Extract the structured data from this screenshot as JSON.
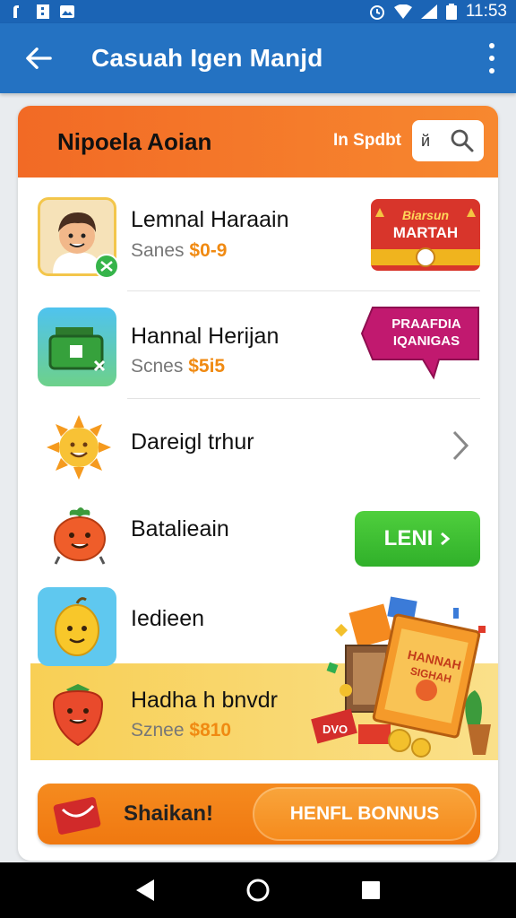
{
  "status_bar": {
    "time": "11:53"
  },
  "app_bar": {
    "title": "Casuah Igen Manjd"
  },
  "card": {
    "title": "Nipoela Aoian",
    "header_label": "In Spdbt",
    "search": {
      "value": "й"
    }
  },
  "rows": [
    {
      "title": "Lemnal Haraain",
      "sub_label": "Sanes",
      "price": "$0-9",
      "badge_line1": "Biarsun",
      "badge_line2": "MARTAH"
    },
    {
      "title": "Hannal Herijan",
      "sub_label": "Scnes",
      "price": "$5i5",
      "badge_line1": "PRAAFDIA",
      "badge_line2": "IQANIGAS"
    },
    {
      "title": "Dareigl trhur"
    },
    {
      "title": "Batalieain",
      "button_label": "LENI"
    },
    {
      "title": "Iedieen"
    },
    {
      "title": "Hadha h bnvdr",
      "sub_label": "Sznee",
      "price": "$810",
      "book_label1": "HANNAH",
      "book_label2": "SIGHAH"
    }
  ],
  "bottom_bar": {
    "left_label": "Shaikan!",
    "right_label": "HENFL BONNUS"
  },
  "colors": {
    "app_bar": "#2472c2",
    "accent": "#f26a25",
    "price": "#f08a12",
    "button_green": "#30b02a"
  }
}
